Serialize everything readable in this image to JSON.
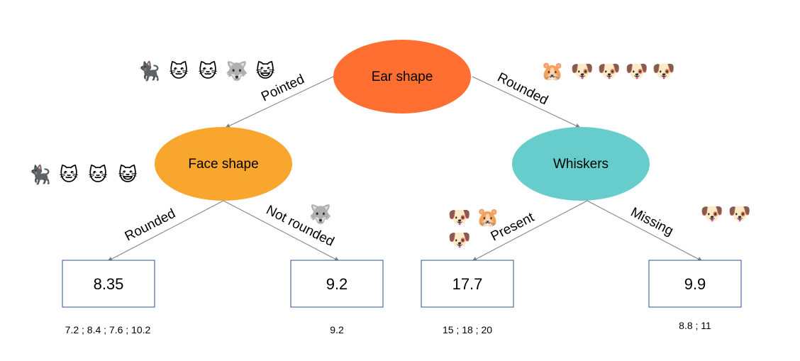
{
  "diagram": {
    "type": "decision-tree",
    "colors": {
      "root": "#FF6F31",
      "face_shape": "#F8A62D",
      "whiskers": "#66CCCC",
      "edge": "#808080",
      "leaf_border": "#2F528F"
    },
    "root": {
      "label": "Ear shape",
      "animals": [
        "🐈‍⬛",
        "🐱",
        "🐱",
        "🐺",
        "😺",
        "🐹",
        "🐶",
        "🐶",
        "🐶",
        "🐶"
      ]
    },
    "nodes": {
      "face_shape": {
        "label": "Face shape",
        "animals_above": [
          "🐈‍⬛",
          "🐱",
          "🐱",
          "🐺",
          "😺"
        ],
        "animals_side": [
          "🐈‍⬛",
          "🐱",
          "🐱",
          "😺"
        ]
      },
      "whiskers": {
        "label": "Whiskers",
        "animals_above": [
          "🐹",
          "🐶",
          "🐶",
          "🐶",
          "🐶"
        ]
      }
    },
    "edges": {
      "pointed": "Pointed",
      "rounded_ear": "Rounded",
      "face_rounded": "Rounded",
      "face_not_rounded": "Not rounded",
      "present": "Present",
      "missing": "Missing"
    },
    "leaves": [
      {
        "value": "8.35",
        "samples": "7.2 ; 8.4 ; 7.6 ; 10.2"
      },
      {
        "value": "9.2",
        "samples": "9.2"
      },
      {
        "value": "17.7",
        "samples": "15 ; 18 ; 20"
      },
      {
        "value": "9.9",
        "samples": "8.8 ; 11"
      }
    ],
    "emoji_groups": {
      "pointed_group": [
        "🐈‍⬛",
        "🐱",
        "🐱",
        "🐺",
        "😺"
      ],
      "rounded_group": [
        "🐹",
        "🐶",
        "🐶",
        "🐶",
        "🐶"
      ],
      "face_rounded_group": [
        "🐈‍⬛",
        "🐱",
        "🐱",
        "😺"
      ],
      "face_not_rounded_group": [
        "🐺"
      ],
      "whiskers_present_group": [
        "🐶",
        "🐹",
        "🐶"
      ],
      "whiskers_missing_group": [
        "🐶",
        "🐶"
      ]
    }
  }
}
